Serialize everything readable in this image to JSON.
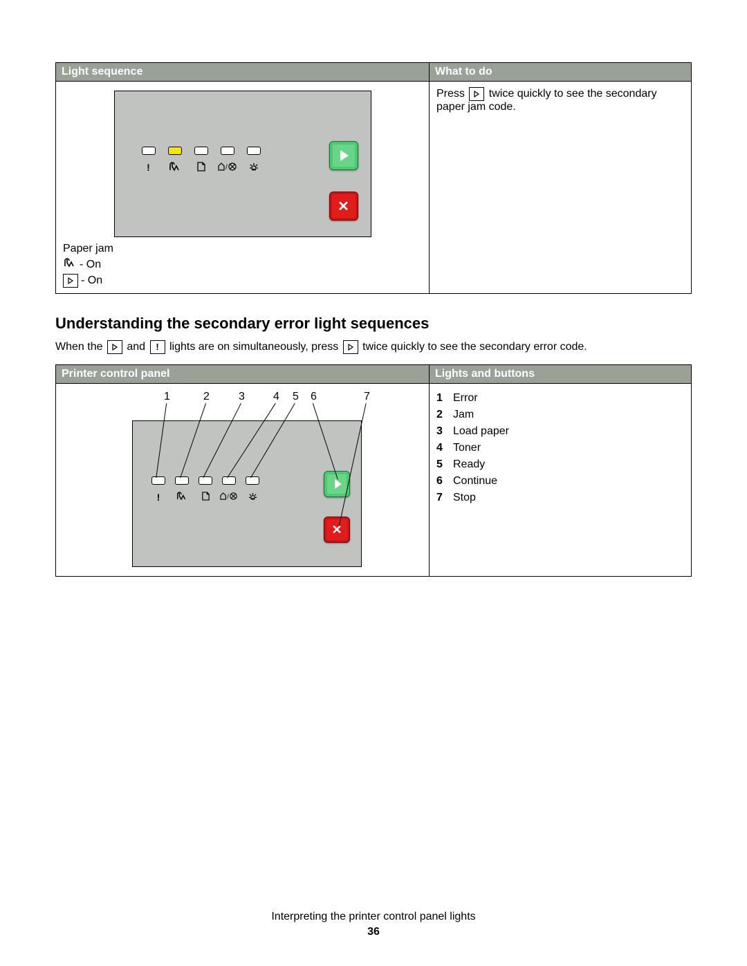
{
  "table1": {
    "head_left": "Light sequence",
    "head_right": "What to do",
    "caption": "Paper jam",
    "legend1_suffix": " - On",
    "legend2_suffix": " - On",
    "action_pre": "Press ",
    "action_post": " twice quickly to see the secondary paper jam code.",
    "panel": {
      "leds": [
        {
          "on": false,
          "icon": "error"
        },
        {
          "on": true,
          "icon": "jam"
        },
        {
          "on": false,
          "icon": "paper"
        },
        {
          "on": false,
          "icon": "toner"
        },
        {
          "on": false,
          "icon": "ready"
        }
      ]
    }
  },
  "section_heading": "Understanding the secondary error light sequences",
  "section_body_1": "When the ",
  "section_body_2": " and ",
  "section_body_3": " lights are on simultaneously, press ",
  "section_body_4": " twice quickly to see the secondary error code.",
  "table2": {
    "head_left": "Printer control panel",
    "head_right": "Lights and buttons",
    "numbers": [
      "1",
      "2",
      "3",
      "4",
      "5",
      "6",
      "7"
    ],
    "legend": [
      "Error",
      "Jam",
      "Load paper",
      "Toner",
      "Ready",
      "Continue",
      "Stop"
    ]
  },
  "footer_line": "Interpreting the printer control panel lights",
  "page_number": "36"
}
